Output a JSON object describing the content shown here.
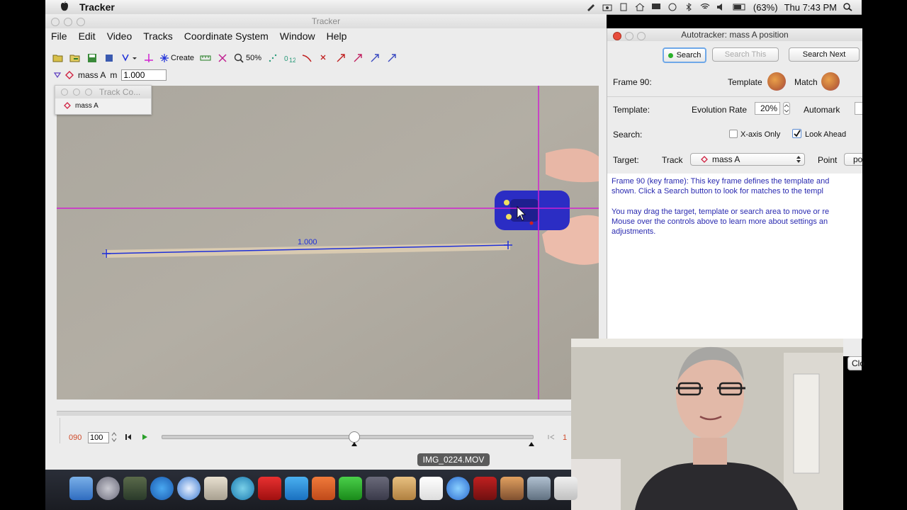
{
  "menubar": {
    "app_name": "Tracker",
    "battery": "(63%)",
    "clock": "Thu 7:43 PM"
  },
  "window": {
    "title": "Tracker",
    "menu": [
      "File",
      "Edit",
      "Video",
      "Tracks",
      "Coordinate System",
      "Window",
      "Help"
    ]
  },
  "toolbar": {
    "create_label": "Create",
    "zoom_label": "50%"
  },
  "track_row": {
    "track_name": "mass A",
    "mass_label": "m",
    "mass_value": "1.000"
  },
  "track_control": {
    "title": "Track Co...",
    "item": "mass A"
  },
  "video": {
    "calibration_label": "1.000",
    "filename": "IMG_0224.MOV"
  },
  "player": {
    "frame": "090",
    "rate": "100",
    "end_mark": "1"
  },
  "autotracker": {
    "title": "Autotracker: mass A position",
    "search_btn": "Search",
    "search_this_btn": "Search This",
    "search_next_btn": "Search Next",
    "frame_label": "Frame 90:",
    "template_label": "Template",
    "match_label": "Match",
    "template_row_label": "Template:",
    "evolution_label": "Evolution Rate",
    "evolution_value": "20%",
    "automark_label": "Automark",
    "search_row_label": "Search:",
    "xaxis_only": "X-axis Only",
    "look_ahead": "Look Ahead",
    "target_row_label": "Target:",
    "track_label": "Track",
    "track_value": "mass A",
    "point_label": "Point",
    "point_value": "po",
    "close_btn": "Clo",
    "message_1a": "Frame 90 (key frame): This key frame defines the template and",
    "message_1b": "shown. Click a Search button to look for matches to the templ",
    "message_2a": "You may drag the target, template or search area to move or re",
    "message_2b": "Mouse over the controls above to learn more about settings an",
    "message_2c": "adjustments."
  },
  "colors": {
    "axis_magenta": "#d022d0",
    "calibration_blue": "#1e2fd8",
    "message_blue": "#2a2ab0"
  }
}
